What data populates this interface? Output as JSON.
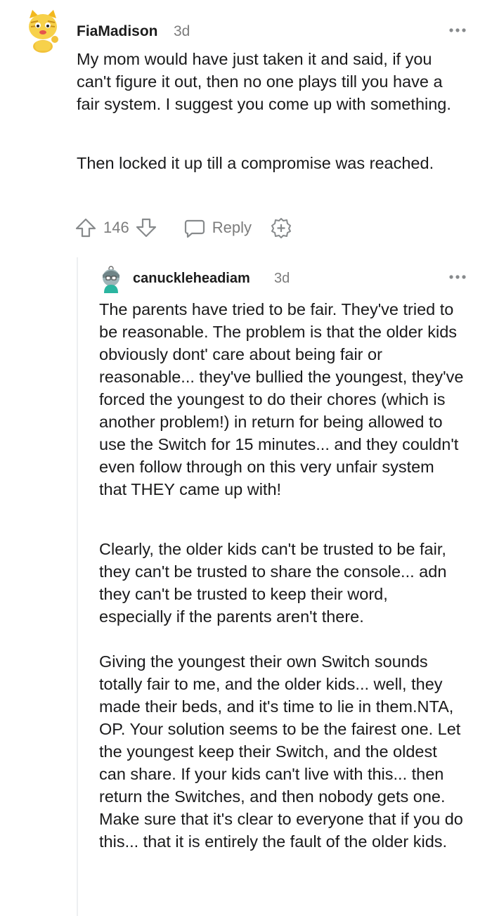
{
  "top_comment": {
    "username": "FiaMadison",
    "time": "3d",
    "more_icon": "ellipsis-icon",
    "paragraphs": [
      "My mom would have just taken it and said, if you can't figure it out, then no one plays till you have a fair system. I suggest you come up with something.",
      "Then locked it up till a compromise was reached."
    ],
    "actions": {
      "upvote_icon": "arrow-up-icon",
      "score": "146",
      "downvote_icon": "arrow-down-icon",
      "reply_icon": "speech-bubble-icon",
      "reply_label": "Reply",
      "award_icon": "plus-badge-icon"
    }
  },
  "reply_comment": {
    "username": "canuckleheadiam",
    "time": "3d",
    "more_icon": "ellipsis-icon",
    "paragraphs": [
      "The parents have tried to be fair. They've tried to be reasonable. The problem is that the older kids obviously dont' care about being fair or reasonable... they've bullied the youngest, they've forced the youngest to do their chores (which is another problem!) in return for being allowed to use the Switch for 15 minutes... and they couldn't even follow through on this very unfair system that THEY came up with!",
      "Clearly, the older kids can't be trusted to be fair, they can't be trusted to share the console... adn they can't be trusted to keep their word, especially if the parents aren't there.",
      "Giving the youngest their own Switch sounds totally fair to me, and the older kids... well, they made their beds, and it's time to lie in them.NTA, OP. Your solution seems to be the fairest one. Let the youngest keep their Switch, and the oldest can share. If your kids can't live with this... then return the Switches, and then nobody gets one. Make sure that it's clear to everyone that if you do this... that it is entirely the fault of the older kids."
    ]
  }
}
